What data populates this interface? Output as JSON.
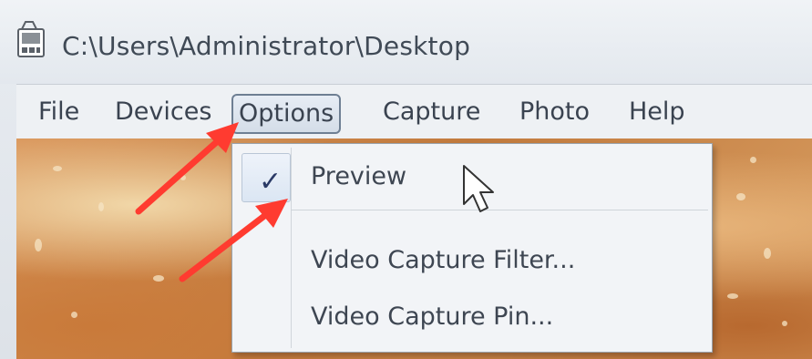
{
  "window": {
    "title": "C:\\Users\\Administrator\\Desktop",
    "icon": "film-camera-icon"
  },
  "menubar": {
    "items": [
      {
        "label": "File"
      },
      {
        "label": "Devices"
      },
      {
        "label": "Options"
      },
      {
        "label": "Capture"
      },
      {
        "label": "Photo"
      },
      {
        "label": "Help"
      }
    ],
    "active_label": "Options"
  },
  "options_menu": {
    "items": [
      {
        "label": "Preview",
        "checked": true
      },
      {
        "label": "Video Capture Filter..."
      },
      {
        "label": "Video Capture Pin..."
      }
    ],
    "check_glyph": "✓"
  },
  "annotations": {
    "arrow_color": "#ff3b30"
  }
}
